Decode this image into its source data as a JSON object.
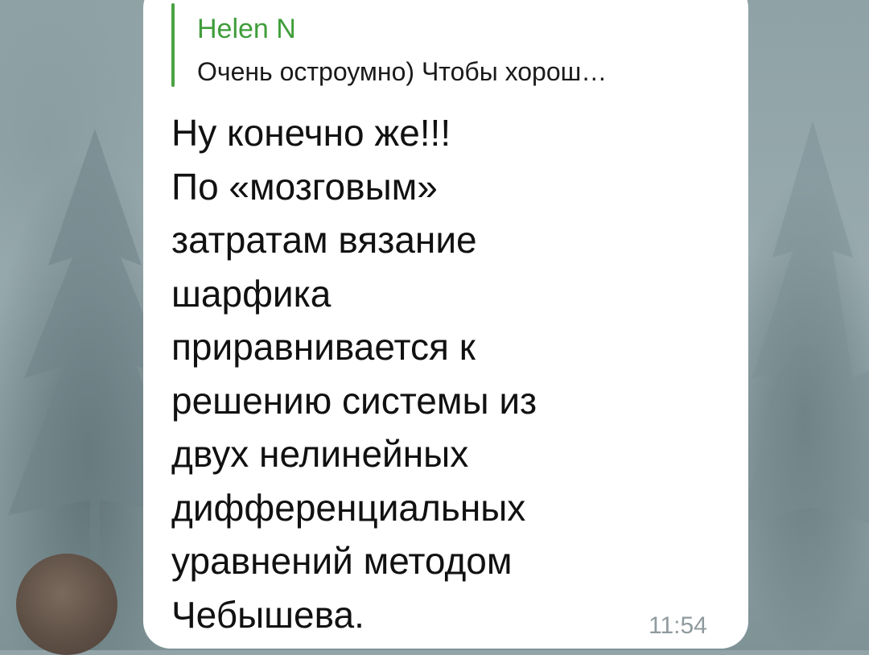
{
  "reply": {
    "author": "Helen N",
    "text": "Очень остроумно) Чтобы хорош…"
  },
  "message": {
    "lines": [
      "Ну конечно же!!!",
      "По «мозговым»",
      "затратам вязание",
      "шарфика",
      "приравнивается к",
      "решению системы из",
      "двух нелинейных",
      "дифференциальных",
      "уравнений методом",
      "Чебышева."
    ],
    "time": "11:54"
  },
  "colors": {
    "reply_accent": "#4aa343",
    "bubble": "#ffffff",
    "time": "#8f9a9e"
  }
}
